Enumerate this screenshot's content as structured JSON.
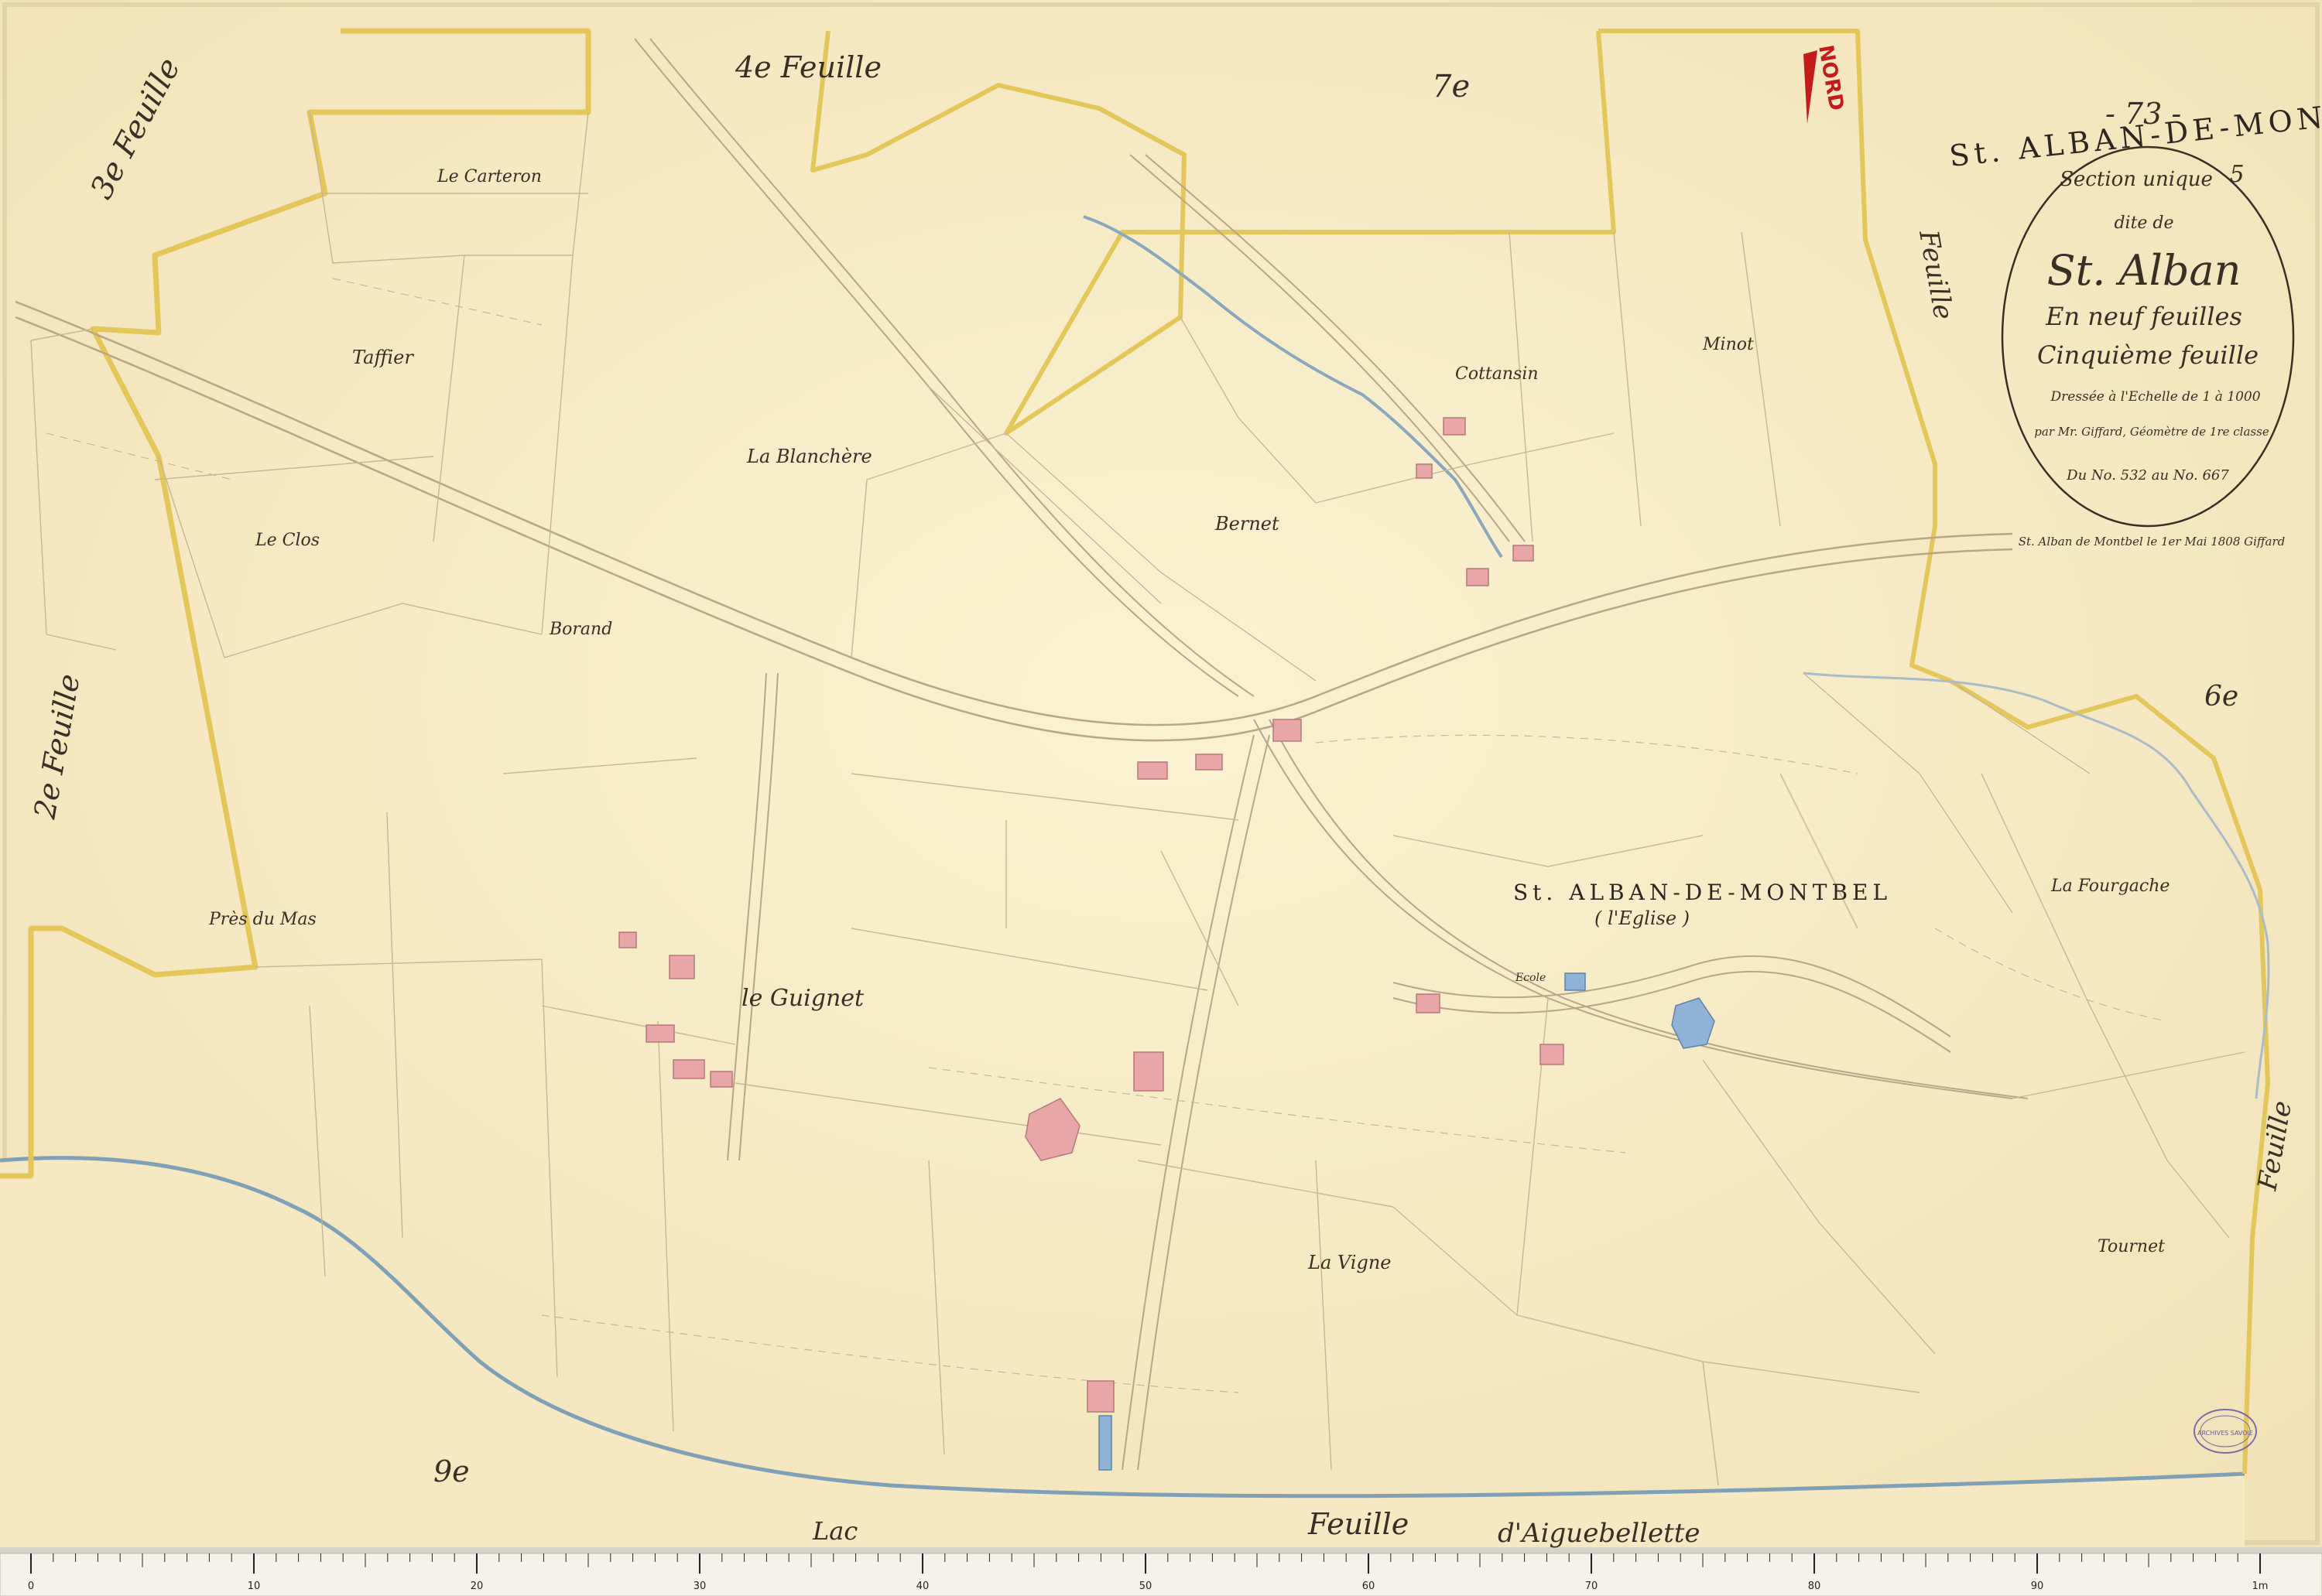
{
  "map": {
    "page_no": "- 73 -",
    "title": "St. ALBAN-DE-MONTBEL",
    "north_label": "NORD",
    "cartouche": {
      "line1": "Section unique",
      "section_letter": "5",
      "line2": "dite de",
      "line3": "St. Alban",
      "line4": "En neuf feuilles",
      "line5": "Cinquième feuille",
      "line6": "Dressée à l'Echelle de 1 à 1000",
      "line7": "par Mr. Giffard, Géomètre de 1re classe",
      "line8": "Du No. 532 au No. 667",
      "signature": "St. Alban de Montbel le 1er Mai 1808 Giffard"
    },
    "stamp": "ARCHIVES SAVOIE",
    "village_name": "St. ALBAN-DE-MONTBEL",
    "village_sub": "( l'Eglise )",
    "lake": "Lac",
    "ecole": "Ecole",
    "places": [
      {
        "id": "carteron",
        "text": "Le Carteron"
      },
      {
        "id": "taffier",
        "text": "Taffier"
      },
      {
        "id": "blanchere",
        "text": "La Blanchère"
      },
      {
        "id": "clos",
        "text": "Le Clos"
      },
      {
        "id": "borand",
        "text": "Borand"
      },
      {
        "id": "bernet",
        "text": "Bernet"
      },
      {
        "id": "cottansin",
        "text": "Cottansin"
      },
      {
        "id": "minot",
        "text": "Minot"
      },
      {
        "id": "pres",
        "text": "Près du Mas"
      },
      {
        "id": "guignet",
        "text": "le Guignet"
      },
      {
        "id": "fourgache",
        "text": "La Fourgache"
      },
      {
        "id": "vigne",
        "text": "La Vigne"
      },
      {
        "id": "tournet",
        "text": "Tournet"
      }
    ],
    "sheets": [
      {
        "id": "f3",
        "text": "3e Feuille"
      },
      {
        "id": "f4",
        "text": "4e Feuille"
      },
      {
        "id": "f7",
        "text": "7e"
      },
      {
        "id": "f5r",
        "text": "Feuille"
      },
      {
        "id": "f6",
        "text": "6e"
      },
      {
        "id": "f6b",
        "text": "Feuille"
      },
      {
        "id": "f2",
        "text": "2e Feuille"
      },
      {
        "id": "f9",
        "text": "9e"
      },
      {
        "id": "fb",
        "text": "Feuille"
      },
      {
        "id": "aig",
        "text": "d'Aiguebellette"
      }
    ]
  },
  "ruler": {
    "labels": [
      "0",
      "10",
      "20",
      "30",
      "40",
      "50",
      "60",
      "70",
      "80",
      "90",
      "1m"
    ]
  },
  "colors": {
    "paper": "#f7ecc8",
    "parcel_line": "#b9a58a",
    "border_yellow": "#e4c75a",
    "building": "#e8a6a6",
    "water": "#9eb7c6",
    "church": "#8fb2d6",
    "north_arrow": "#c41b1b"
  }
}
